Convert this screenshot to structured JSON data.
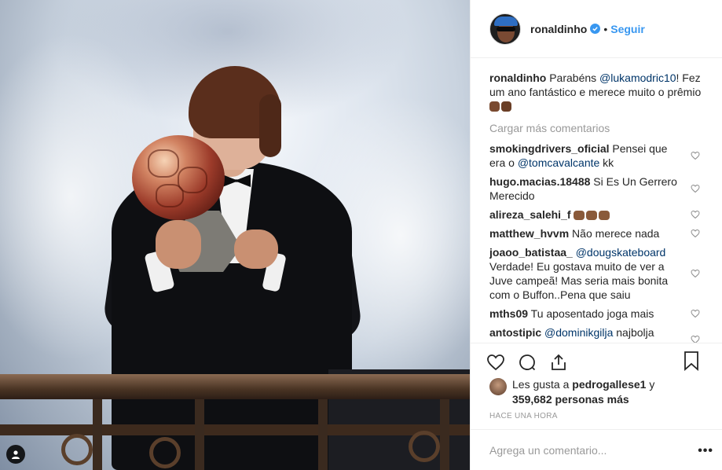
{
  "post": {
    "image_alt": "",
    "tag_icon": "user-tag-icon"
  },
  "header": {
    "username": "ronaldinho",
    "separator": "•",
    "follow_label": "Seguir"
  },
  "caption": {
    "username": "ronaldinho",
    "text_before": "Parabéns ",
    "mention": "@lukamodric10",
    "text_after": "! Fez um ano fantástico e merece muito o prêmio "
  },
  "load_more": "Cargar más comentarios",
  "comments": [
    {
      "username": "smokingdrivers_oficial",
      "text_before": "Pensei que era o ",
      "mention": "@tomcavalcante",
      "text_after": " kk"
    },
    {
      "username": "hugo.macias.18488",
      "text_before": "Si Es Un Gerrero Merecido",
      "mention": "",
      "text_after": ""
    },
    {
      "username": "alireza_salehi_f",
      "text_before": "",
      "mention": "",
      "text_after": "",
      "emoji": [
        "thumbs-down",
        "thumbs-down",
        "thumbs-down"
      ]
    },
    {
      "username": "matthew_hvvm",
      "text_before": "Não merece nada",
      "mention": "",
      "text_after": ""
    },
    {
      "username": "joaoo_batistaa_",
      "text_before": "",
      "mention": "@dougskateboard",
      "text_after": " Verdade! Eu gostava muito de ver a Juve campeã! Mas seria mais bonita com o Buffon..Pena que saiu"
    },
    {
      "username": "mths09",
      "text_before": "Tu aposentado joga mais",
      "mention": "",
      "text_after": ""
    },
    {
      "username": "antostipic",
      "text_before": "",
      "mention": "@dominikgilja",
      "text_after": " najbolja čestitka"
    }
  ],
  "likes": {
    "prefix": "Les gusta a ",
    "user": "pedrogallese1",
    "mid": " y ",
    "count": "359,682 personas más"
  },
  "timestamp": "Hace una hora",
  "add_comment": {
    "placeholder": "Agrega un comentario..."
  },
  "options_label": "•••",
  "colors": {
    "link": "#3897f0",
    "mention": "#003569",
    "muted": "#999999",
    "border": "#efefef"
  }
}
